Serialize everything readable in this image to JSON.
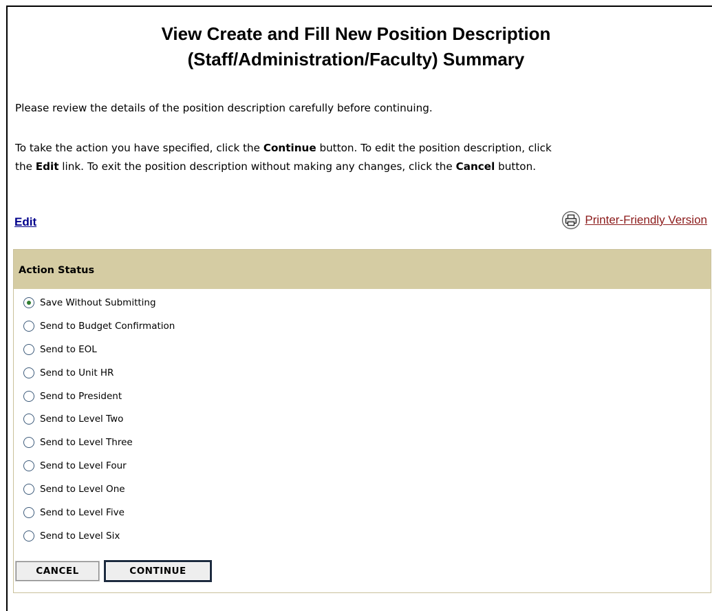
{
  "page": {
    "title_line1": "View Create and Fill New Position Description",
    "title_line2": "(Staff/Administration/Faculty) Summary"
  },
  "intro": {
    "p1": "Please review the details of the position description carefully before continuing.",
    "p2_a": "To take the action you have specified, click the ",
    "p2_b": "Continue",
    "p2_c": " button. To edit the position description, click",
    "p3_a": "the ",
    "p3_b": "Edit",
    "p3_c": " link. To exit the position description without making any changes, click the ",
    "p3_d": "Cancel",
    "p3_e": " button."
  },
  "links": {
    "edit": "Edit",
    "printer": "Printer-Friendly Version",
    "printer_icon": "printer-icon"
  },
  "action_status": {
    "header": "Action Status",
    "selected_index": 0,
    "options": [
      "Save Without Submitting",
      "Send to Budget Confirmation",
      "Send to EOL",
      "Send to Unit HR",
      "Send to President",
      "Send to Level Two",
      "Send to Level Three",
      "Send to Level Four",
      "Send to Level One",
      "Send to Level Five",
      "Send to Level Six"
    ]
  },
  "buttons": {
    "cancel": "CANCEL",
    "continue": "CONTINUE"
  },
  "colors": {
    "panel_header": "#d5cca3",
    "edit_link": "#00008b",
    "printer_link": "#8b1a1a",
    "radio_selected": "#2f7d2f"
  }
}
